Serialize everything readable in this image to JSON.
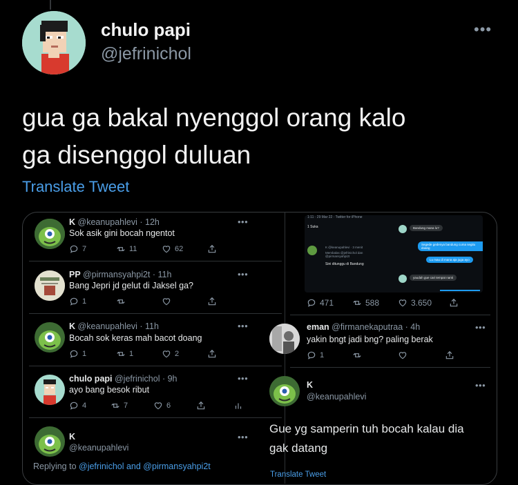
{
  "tweet": {
    "name": "chulo papi",
    "handle": "@jefrinichol",
    "text_line1": "gua ga bakal nyenggol orang kalo",
    "text_line2": "ga disenggol duluan",
    "translate": "Translate Tweet",
    "more": "•••"
  },
  "left_replies": [
    {
      "name": "K",
      "handle": "@keanupahlevi",
      "time": "· 12h",
      "text": "Sok asik gini bocah ngentot",
      "replies": "7",
      "retweets": "11",
      "likes": "62"
    },
    {
      "name": "PP",
      "handle": "@pirmansyahpi2t",
      "time": "· 11h",
      "text": "Bang Jepri jd gelut di Jaksel ga?",
      "replies": "1",
      "retweets": "",
      "likes": ""
    },
    {
      "name": "K",
      "handle": "@keanupahlevi",
      "time": "· 11h",
      "text": "Bocah sok keras mah bacot doang",
      "replies": "1",
      "retweets": "1",
      "likes": "2"
    },
    {
      "name": "chulo papi",
      "handle": "@jefrinichol",
      "time": "· 9h",
      "text": "ayo bang besok ribut",
      "replies": "4",
      "retweets": "7",
      "likes": "6"
    },
    {
      "name": "K",
      "handle": "@keanupahlevi"
    }
  ],
  "replying_to": {
    "prefix": "Replying to ",
    "users": "@jefrinichol and @pirmansyahpi2t"
  },
  "right_panel": {
    "top_stats": {
      "replies": "471",
      "retweets": "588",
      "likes": "3.650"
    },
    "eman": {
      "name": "eman",
      "handle": "@firmanekaputraa",
      "time": "· 4h",
      "text": "yakin bngt jadi bng? paling berak",
      "replies": "1"
    },
    "k_focus": {
      "name": "K",
      "handle": "@keanupahlevi",
      "text_line1": "Gue yg samperin tuh bocah kalau dia",
      "text_line2": "gak datang",
      "translate": "Translate Tweet"
    },
    "screenshot": {
      "meta": "1:11 · 29 Mar 22 · Twitter for iPhone",
      "like_count": "1 Suka",
      "inner_handle": "K @keanupahlevi · 3 menit",
      "inner_replying": "Membalas @jefrinichol dan @pirmansyahpi2t",
      "inner_text": "Sini ditunggu di Bandung",
      "dm1": "Bandung mana lu?",
      "dm2": "Segede gedenya bandung cuma segitu doang",
      "dm3": "Lu mau di mana aja juga ayo",
      "dm4": "yaudah gue cari tempat nanti"
    }
  },
  "colors": {
    "link": "#4a9ee8",
    "muted": "#8b98a5",
    "text": "#e7e9ea",
    "border": "#3a3d40"
  }
}
